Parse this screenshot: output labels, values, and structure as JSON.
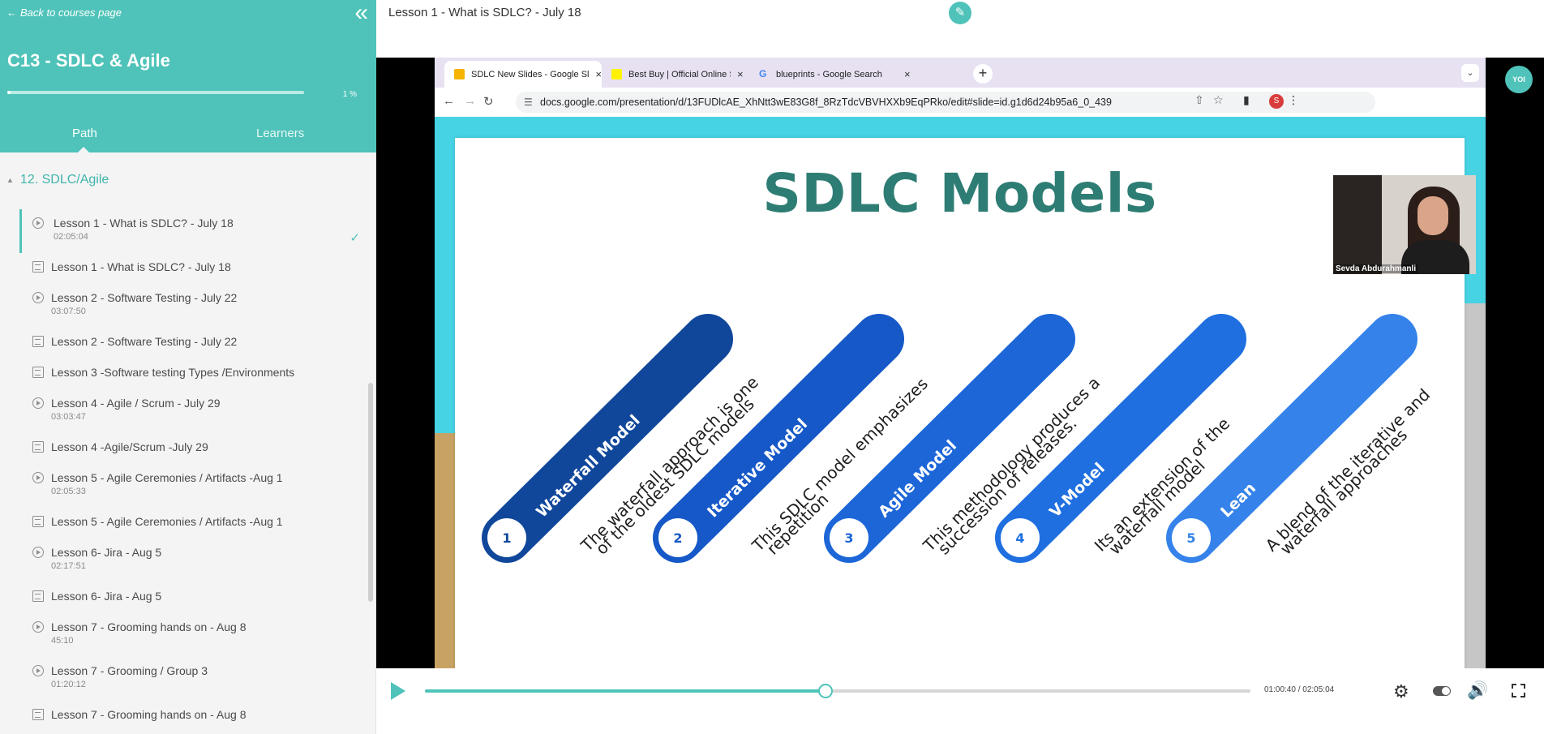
{
  "sidebar": {
    "back_label": "Back to courses page",
    "course_title": "C13 - SDLC & Agile",
    "progress_value": 0.01,
    "progress_label": "1 %",
    "tabs": {
      "path": "Path",
      "learners": "Learners"
    },
    "section_title": "12. SDLC/Agile",
    "lessons": [
      {
        "type": "video",
        "title": "Lesson 1 - What is SDLC? - July 18",
        "duration": "02:05:04",
        "active": true,
        "completed": true
      },
      {
        "type": "document",
        "title": "Lesson 1 - What is SDLC? - July 18"
      },
      {
        "type": "video",
        "title": "Lesson 2 - Software Testing - July 22",
        "duration": "03:07:50"
      },
      {
        "type": "document",
        "title": "Lesson 2 - Software Testing - July 22"
      },
      {
        "type": "document",
        "title": "Lesson 3 -Software testing Types /Environments"
      },
      {
        "type": "video",
        "title": "Lesson 4 - Agile / Scrum - July 29",
        "duration": "03:03:47"
      },
      {
        "type": "document",
        "title": "Lesson 4 -Agile/Scrum -July 29"
      },
      {
        "type": "video",
        "title": "Lesson 5 - Agile Ceremonies / Artifacts -Aug 1",
        "duration": "02:05:33"
      },
      {
        "type": "document",
        "title": "Lesson 5 - Agile Ceremonies / Artifacts -Aug 1"
      },
      {
        "type": "video",
        "title": "Lesson 6- Jira - Aug 5",
        "duration": "02:17:51"
      },
      {
        "type": "document",
        "title": "Lesson 6- Jira - Aug 5"
      },
      {
        "type": "video",
        "title": "Lesson 7 - Grooming hands on - Aug 8",
        "duration": "45:10"
      },
      {
        "type": "video",
        "title": "Lesson 7 - Grooming / Group 3",
        "duration": "01:20:12"
      },
      {
        "type": "document",
        "title": "Lesson 7 - Grooming hands on - Aug 8"
      }
    ]
  },
  "main": {
    "lesson_title": "Lesson 1 - What is SDLC? - July 18"
  },
  "browser": {
    "tabs": [
      {
        "title": "SDLC New Slides - Google Slides",
        "favicon_color": "#f4b400",
        "active": true
      },
      {
        "title": "Best Buy | Official Online Store",
        "favicon_color": "#fff200",
        "active": false
      },
      {
        "title": "blueprints - Google Search",
        "favicon_color": "#4285f4",
        "active": false
      }
    ],
    "url": "docs.google.com/presentation/d/13FUDlcAE_XhNtt3wE83G8f_8RzTdcVBVHXXb9EqPRko/edit#slide=id.g1d6d24b95a6_0_439",
    "profile_initial": "S"
  },
  "slide": {
    "title": "SDLC Models",
    "models": [
      {
        "number": "1",
        "name": "Waterfall Model",
        "description": [
          "The waterfall approach is one",
          "of the oldest SDLC models"
        ],
        "color": "#10479b"
      },
      {
        "number": "2",
        "name": "Iterative Model",
        "description": [
          "This SDLC model emphasizes",
          "repetition"
        ],
        "color": "#1658c7"
      },
      {
        "number": "3",
        "name": "Agile Model",
        "description": [
          "This methodology produces a",
          "succession of releases."
        ],
        "color": "#1c66d8"
      },
      {
        "number": "4",
        "name": "V-Model",
        "description": [
          "Its an extension of the",
          "waterfall model"
        ],
        "color": "#1f6fe0"
      },
      {
        "number": "5",
        "name": "Lean",
        "description": [
          "A blend of the iterative and",
          "waterfall approaches"
        ],
        "color": "#3583ea"
      }
    ]
  },
  "webcam": {
    "participant_name": "Sevda Abdurahmanli"
  },
  "player": {
    "logo_text": "YOI",
    "current_time": "01:00:40",
    "total_time": "02:05:04",
    "time_display": "01:00:40 / 02:05:04",
    "progress_value": 0.4852
  },
  "icons": {
    "back": "arrow-left-icon",
    "collapse": "double-chevron-left-icon",
    "edit": "pencil-icon",
    "play": "play-icon",
    "settings": "gear-icon",
    "volume": "volume-icon",
    "fullscreen": "fullscreen-icon"
  },
  "colors": {
    "accent": "#4fc3b9",
    "slide_title": "#2e7d74",
    "slide_background": "#46d3e3"
  }
}
